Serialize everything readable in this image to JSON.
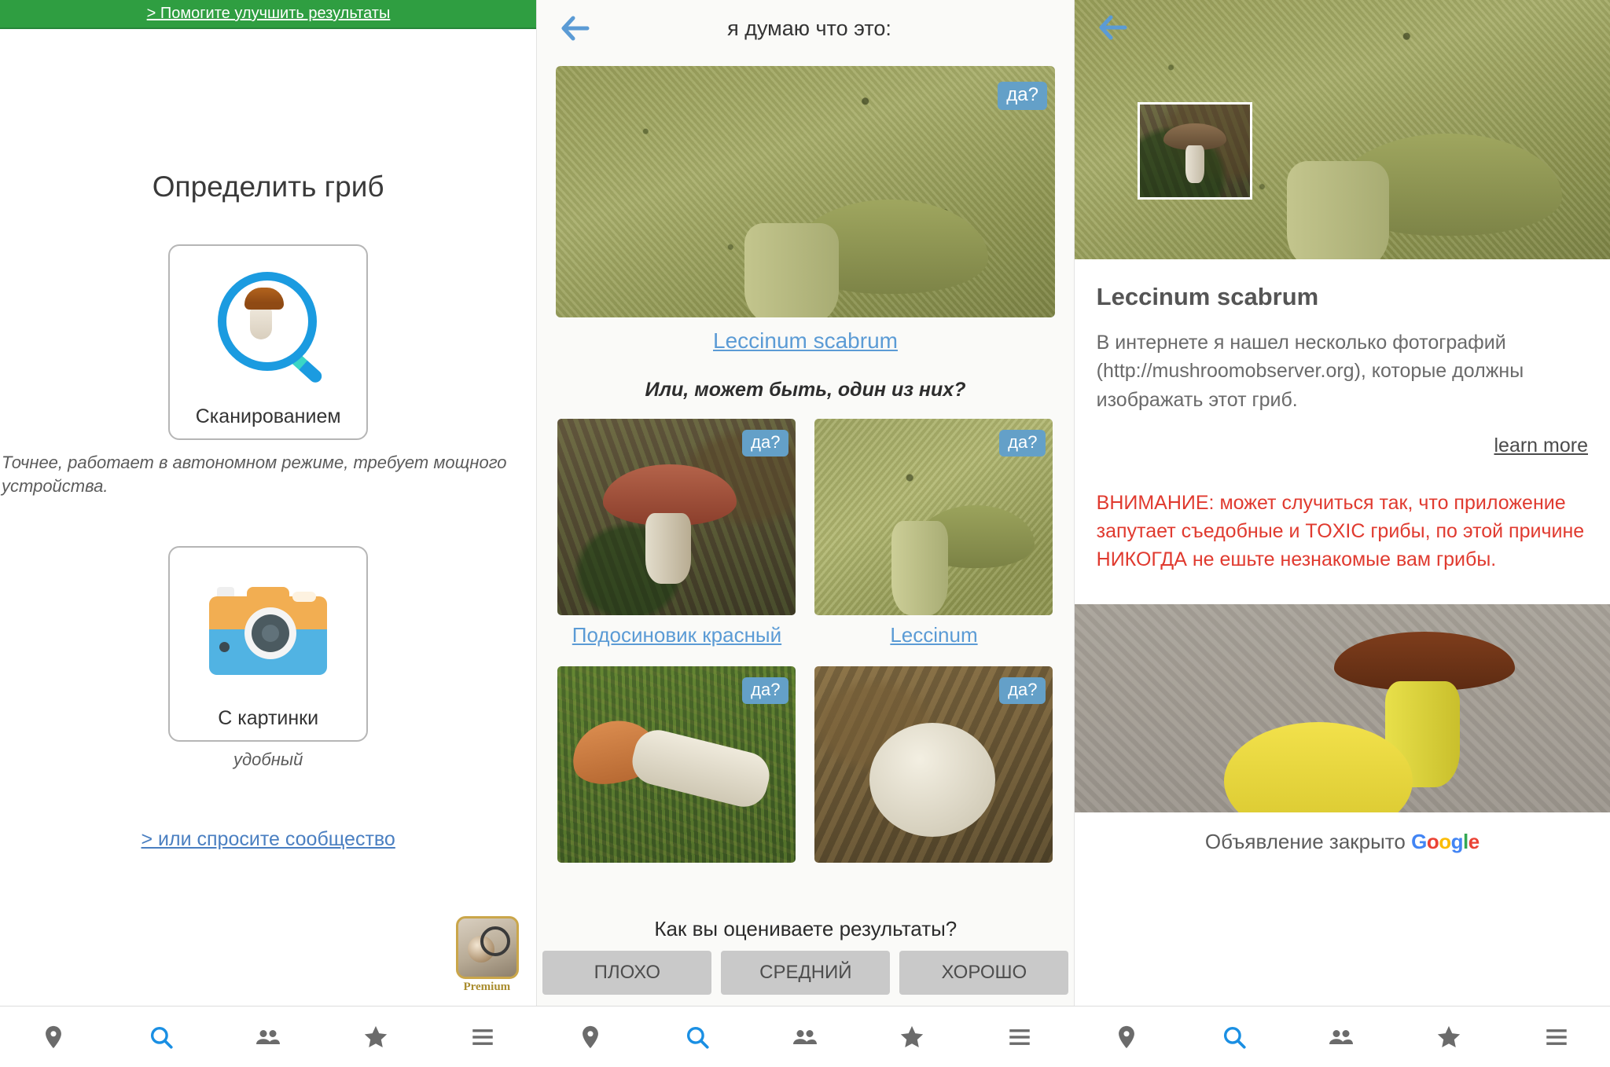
{
  "panel1": {
    "banner_link": "> Помогите улучшить результаты",
    "title": "Определить гриб",
    "options": [
      {
        "label": "Сканированием",
        "icon": "magnifier-mushroom-icon",
        "note": "Точнее, работает в автономном режиме, требует мощного устройства."
      },
      {
        "label": "С картинки",
        "icon": "camera-icon",
        "note": "удобный"
      }
    ],
    "community_link": "> или спросите сообщество",
    "premium_badge": "Premium"
  },
  "panel2": {
    "back_icon": "back-arrow-icon",
    "title": "я думаю что это:",
    "hero": {
      "badge": "да?",
      "caption": "Leccinum scabrum",
      "photo": "mushroom-stem-closeup"
    },
    "or_text": "Или, может быть, один из них?",
    "candidates": [
      {
        "badge": "да?",
        "caption": "Подосиновик красный",
        "photo": "red-capped-mushroom"
      },
      {
        "badge": "да?",
        "caption": "Leccinum",
        "photo": "mushroom-stem-green"
      },
      {
        "badge": "да?",
        "caption": "",
        "photo": "orange-mushroom-on-moss"
      },
      {
        "badge": "да?",
        "caption": "",
        "photo": "white-puffball-on-leaves"
      }
    ],
    "rating_question": "Как вы оцениваете результаты?",
    "rating_buttons": [
      "ПЛОХО",
      "СРЕДНИЙ",
      "ХОРОШО"
    ]
  },
  "panel3": {
    "back_icon": "back-arrow-icon",
    "thumbnail": "mushroom-thumbnail",
    "title": "Leccinum scabrum",
    "description": "В интернете я нашел несколько фотографий (http://mushroomobserver.org), которые должны изображать этот гриб.",
    "learn_more": "learn more",
    "warning": "ВНИМАНИЕ: может случиться так, что приложение запутает съедобные и TOXIC грибы, по этой причине НИКОГДА не ешьте незнакомые вам грибы.",
    "ad_note": "Объявление закрыто",
    "ad_brand": "Google",
    "ad_photo": "bolete-mushroom-photo"
  },
  "navbar": {
    "items": [
      {
        "name": "location-pin-icon",
        "active": false
      },
      {
        "name": "search-icon",
        "active": true
      },
      {
        "name": "people-icon",
        "active": false
      },
      {
        "name": "star-icon",
        "active": false
      },
      {
        "name": "menu-icon",
        "active": false
      }
    ],
    "groups": 3
  },
  "colors": {
    "banner_green": "#2f9e41",
    "link_blue": "#5b9bd5",
    "badge_blue": "#64a0c8",
    "warning_red": "#e03a2f",
    "nav_active": "#1a8fe3",
    "nav_inactive": "#6b6b6b"
  }
}
